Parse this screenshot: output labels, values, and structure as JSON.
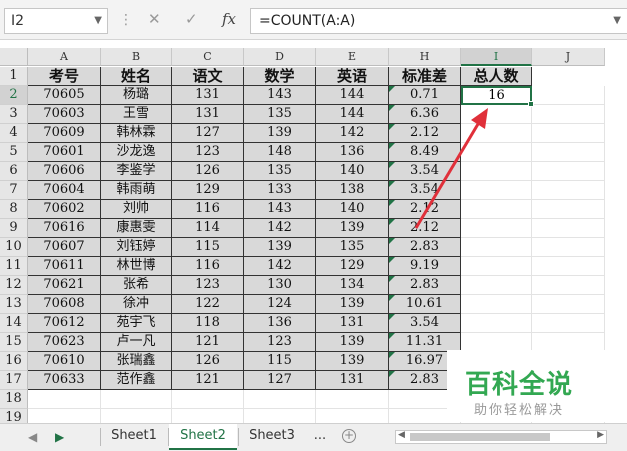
{
  "formula_bar": {
    "name_box": "I2",
    "cancel_icon": "✕",
    "enter_icon": "✓",
    "fx_label": "fx",
    "formula": "=COUNT(A:A)"
  },
  "columns": [
    "A",
    "B",
    "C",
    "D",
    "E",
    "H",
    "I",
    "J"
  ],
  "selected_column": "I",
  "rows": [
    "1",
    "2",
    "3",
    "4",
    "5",
    "6",
    "7",
    "8",
    "9",
    "10",
    "11",
    "12",
    "13",
    "14",
    "15",
    "16",
    "17",
    "18",
    "19"
  ],
  "selected_row": "2",
  "table": {
    "headers": [
      "考号",
      "姓名",
      "语文",
      "数学",
      "英语",
      "标准差",
      "总人数"
    ],
    "data": [
      [
        "70605",
        "杨璐",
        "131",
        "143",
        "144",
        "0.71"
      ],
      [
        "70603",
        "王雪",
        "131",
        "135",
        "144",
        "6.36"
      ],
      [
        "70609",
        "韩林霖",
        "127",
        "139",
        "142",
        "2.12"
      ],
      [
        "70601",
        "沙龙逸",
        "123",
        "148",
        "136",
        "8.49"
      ],
      [
        "70606",
        "李鉴学",
        "126",
        "135",
        "140",
        "3.54"
      ],
      [
        "70604",
        "韩雨萌",
        "129",
        "133",
        "138",
        "3.54"
      ],
      [
        "70602",
        "刘帅",
        "116",
        "143",
        "140",
        "2.12"
      ],
      [
        "70616",
        "康惠雯",
        "114",
        "142",
        "139",
        "2.12"
      ],
      [
        "70607",
        "刘钰婷",
        "115",
        "139",
        "135",
        "2.83"
      ],
      [
        "70611",
        "林世博",
        "116",
        "142",
        "129",
        "9.19"
      ],
      [
        "70621",
        "张希",
        "123",
        "130",
        "134",
        "2.83"
      ],
      [
        "70608",
        "徐冲",
        "122",
        "124",
        "139",
        "10.61"
      ],
      [
        "70612",
        "苑宇飞",
        "118",
        "136",
        "131",
        "3.54"
      ],
      [
        "70623",
        "卢一凡",
        "121",
        "123",
        "139",
        "11.31"
      ],
      [
        "70610",
        "张瑞鑫",
        "126",
        "115",
        "139",
        "16.97"
      ],
      [
        "70633",
        "范作鑫",
        "121",
        "127",
        "131",
        "2.83"
      ]
    ],
    "total_count": "16"
  },
  "sheets": [
    "Sheet1",
    "Sheet2",
    "Sheet3"
  ],
  "active_sheet": "Sheet2",
  "more_tabs": "...",
  "watermark": {
    "title": "百科全说",
    "subtitle": "助你轻松解决"
  },
  "colors": {
    "excel_green": "#217346",
    "arrow_red": "#e0303a",
    "cell_fill": "#d9d9d9"
  }
}
